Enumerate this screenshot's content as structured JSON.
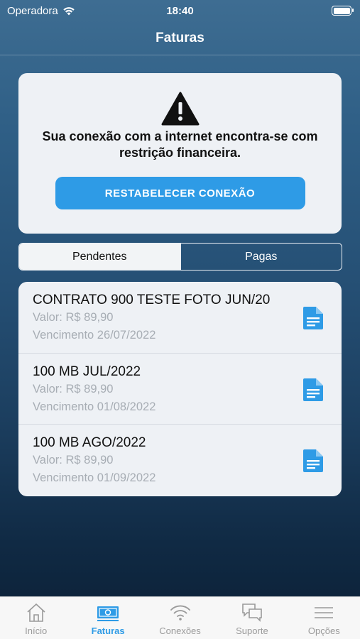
{
  "status_bar": {
    "carrier": "Operadora",
    "time": "18:40"
  },
  "header": {
    "title": "Faturas"
  },
  "alert": {
    "message": "Sua conexão com a internet encontra-se com restrição financeira.",
    "button_label": "RESTABELECER CONEXÃO"
  },
  "segments": {
    "pending": "Pendentes",
    "paid": "Pagas"
  },
  "invoices": [
    {
      "title": "CONTRATO 900 TESTE FOTO JUN/20",
      "value": "Valor: R$ 89,90",
      "due": "Vencimento 26/07/2022"
    },
    {
      "title": "100 MB JUL/2022",
      "value": "Valor: R$ 89,90",
      "due": "Vencimento 01/08/2022"
    },
    {
      "title": "100 MB AGO/2022",
      "value": "Valor: R$ 89,90",
      "due": "Vencimento 01/09/2022"
    }
  ],
  "tabs": [
    {
      "label": "Início",
      "icon": "home-icon"
    },
    {
      "label": "Faturas",
      "icon": "money-icon"
    },
    {
      "label": "Conexões",
      "icon": "wifi-icon"
    },
    {
      "label": "Suporte",
      "icon": "chat-icon"
    },
    {
      "label": "Opções",
      "icon": "menu-icon"
    }
  ],
  "colors": {
    "accent": "#2e9be6",
    "card": "#eef1f5",
    "muted_text": "#a7adb4"
  }
}
